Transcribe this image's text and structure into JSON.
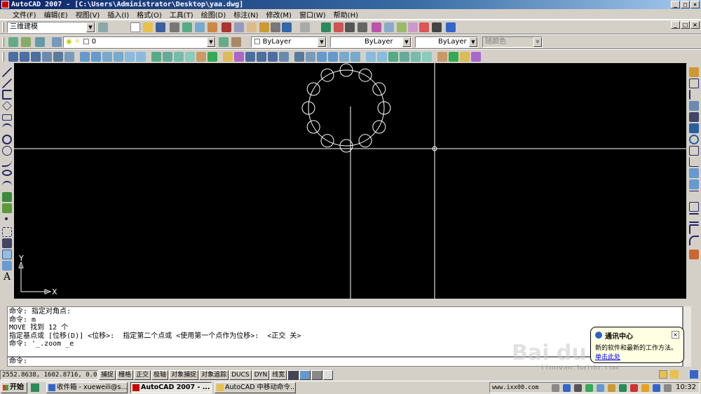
{
  "window": {
    "title": "AutoCAD 2007 - [C:\\Users\\Administrator\\Desktop\\yaa.dwg]",
    "min": "_",
    "max": "□",
    "close": "×"
  },
  "menu": [
    "文件(F)",
    "编辑(E)",
    "视图(V)",
    "插入(I)",
    "格式(O)",
    "工具(T)",
    "绘图(D)",
    "标注(N)",
    "修改(M)",
    "窗口(W)",
    "帮助(H)"
  ],
  "toolbar1": {
    "workspace": "三维建模"
  },
  "toolbar2": {
    "layer": "0",
    "color": "ByLayer",
    "linetype": "ByLayer",
    "lineweight": "ByLayer",
    "plotstyle": "随颜色"
  },
  "canvas": {
    "ucs_y": "Y",
    "ucs_x": "X"
  },
  "command_history": [
    "命令: 指定对角点:",
    "命令: m",
    "MOVE 找到 12 个",
    "指定基点或 [位移(D)] <位移>:  指定第二个点或 <使用第一个点作为位移>:  <正交 关>",
    "命令: '_.zoom _e"
  ],
  "command_prompt": "命令:",
  "status": {
    "coords": "2552.8638,  1602.8716, 0.0000",
    "buttons": [
      "捕捉",
      "栅格",
      "正交",
      "极轴",
      "对象捕捉",
      "对象追踪",
      "DUCS",
      "DYN",
      "线宽"
    ]
  },
  "balloon": {
    "title": "通讯中心",
    "body": "新的软件和最新的工作方法。",
    "link": "单击此处",
    "close": "×"
  },
  "watermark": {
    "main": "Bai du 经验",
    "sub": "jingyan.baidu.com"
  },
  "taskbar": {
    "start": "开始",
    "tasks": [
      "收件箱 - xueweili@s...",
      "AutoCAD 2007 - ...",
      "AutoCAD 中移动命令..."
    ],
    "url": "www.ixx00.com",
    "clock": "10:32"
  },
  "colors": {
    "canvas_bg": "#000000",
    "accent": "#0a246a"
  }
}
